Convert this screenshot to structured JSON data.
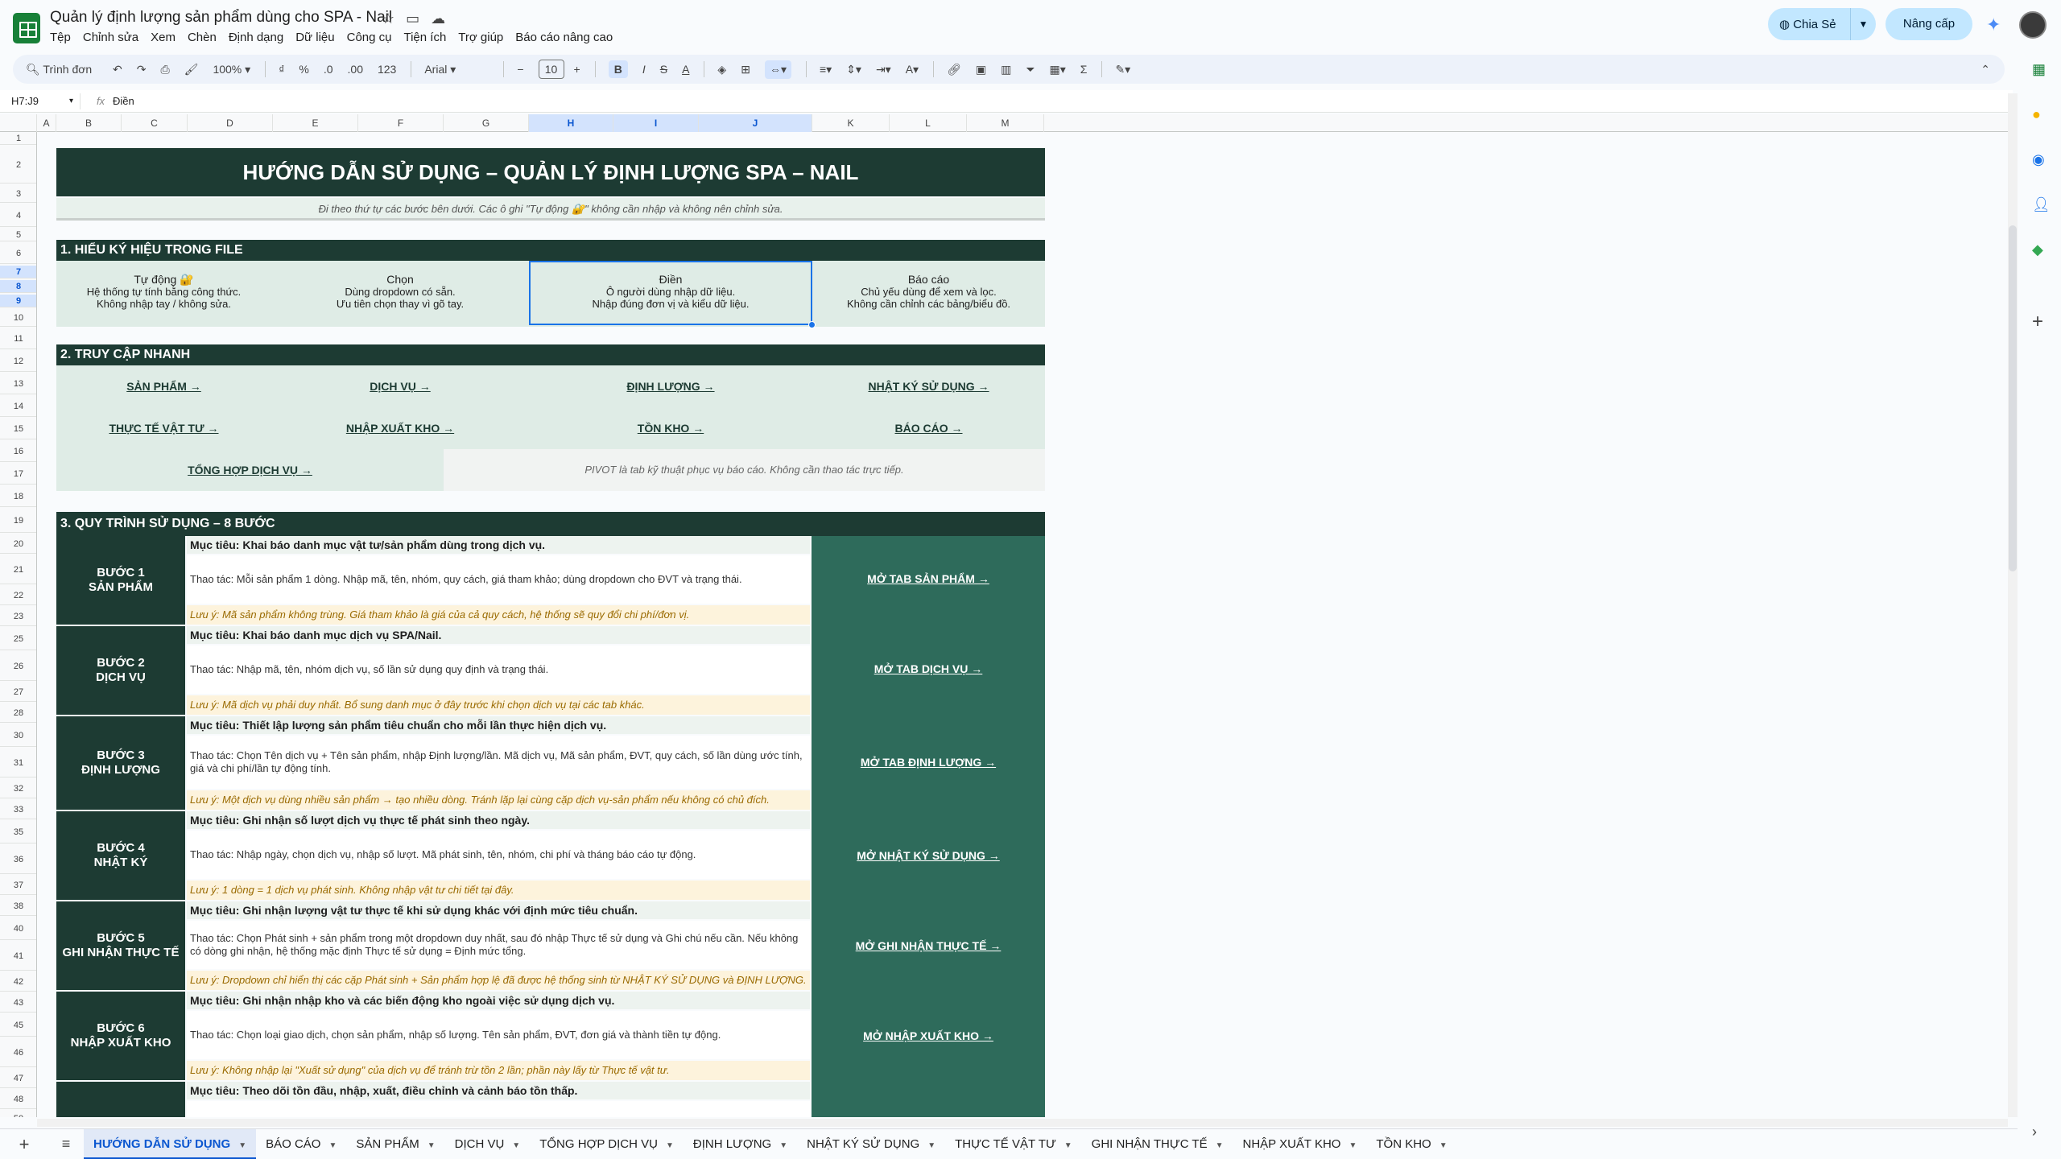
{
  "doc_title": "Quản lý định lượng sản phẩm dùng cho SPA - Nail",
  "menu": [
    "Tệp",
    "Chỉnh sửa",
    "Xem",
    "Chèn",
    "Định dạng",
    "Dữ liệu",
    "Công cụ",
    "Tiện ích",
    "Trợ giúp",
    "Báo cáo nâng cao"
  ],
  "share_label": "Chia Sẻ",
  "upgrade_label": "Nâng cấp",
  "toolbar": {
    "search": "Trình đơn",
    "zoom": "100%",
    "font": "Arial",
    "font_size": "10",
    "currency": "₫",
    "percent": "%",
    "dec_dec": ".0",
    "dec_inc": ".00",
    "num_fmt": "123"
  },
  "namebox": "H7:J9",
  "formula": "Điền",
  "columns": [
    "A",
    "B",
    "C",
    "D",
    "E",
    "F",
    "G",
    "H",
    "I",
    "J",
    "K",
    "L",
    "M"
  ],
  "rows": [
    "1",
    "2",
    "3",
    "4",
    "5",
    "6",
    "7",
    "8",
    "9",
    "10",
    "11",
    "12",
    "13",
    "14",
    "15",
    "16",
    "17",
    "18",
    "19",
    "20",
    "21",
    "22",
    "23",
    "25",
    "26",
    "27",
    "28",
    "30",
    "31",
    "32",
    "33",
    "35",
    "36",
    "37",
    "38",
    "40",
    "41",
    "42",
    "43",
    "45",
    "46",
    "47",
    "48",
    "50"
  ],
  "main_title": "HƯỚNG DẪN SỬ DỤNG – QUẢN LÝ ĐỊNH LƯỢNG SPA – NAIL",
  "subnote": "Đi theo thứ tự các bước bên dưới. Các ô ghi \"Tự động 🔐\" không cần nhập và không nên chỉnh sửa.",
  "sec1": "1. HIỂU KÝ HIỆU TRONG FILE",
  "legend": [
    {
      "h": "Tự động 🔐",
      "l1": "Hệ thống tự tính bằng công thức.",
      "l2": "Không nhập tay / không sửa."
    },
    {
      "h": "Chọn",
      "l1": "Dùng dropdown có sẵn.",
      "l2": "Ưu tiên chọn thay vì gõ tay."
    },
    {
      "h": "Điền",
      "l1": "Ô người dùng nhập dữ liệu.",
      "l2": "Nhập đúng đơn vị và kiểu dữ liệu."
    },
    {
      "h": "Báo cáo",
      "l1": "Chủ yếu dùng để xem và lọc.",
      "l2": "Không cần chỉnh các bảng/biểu đồ."
    }
  ],
  "sec2": "2. TRUY CẬP NHANH",
  "quick_links": [
    "SẢN PHẨM →",
    "DỊCH VỤ →",
    "ĐỊNH LƯỢNG →",
    "NHẬT KÝ SỬ DỤNG →",
    "THỰC TẾ VẬT TƯ →",
    "NHẬP XUẤT KHO →",
    "TỒN KHO →",
    "BÁO CÁO →",
    "TỔNG HỢP DỊCH VỤ →"
  ],
  "pivot_note": "PIVOT là tab kỹ thuật phục vụ báo cáo. Không cần thao tác trực tiếp.",
  "sec3": "3. QUY TRÌNH SỬ DỤNG – 8 BƯỚC",
  "steps": [
    {
      "l1": "BƯỚC 1",
      "l2": "SẢN PHẨM",
      "goal": "Mục tiêu: Khai báo danh mục vật tư/sản phẩm dùng trong dịch vụ.",
      "op": "Thao tác: Mỗi sản phẩm 1 dòng. Nhập mã, tên, nhóm, quy cách, giá tham khảo; dùng dropdown cho ĐVT và trạng thái.",
      "note": "Lưu ý: Mã sản phẩm không trùng. Giá tham khảo là giá của cả quy cách, hệ thống sẽ quy đổi chi phí/đơn vị.",
      "link": "MỞ TAB SẢN PHẨM →"
    },
    {
      "l1": "BƯỚC 2",
      "l2": "DỊCH VỤ",
      "goal": "Mục tiêu: Khai báo danh mục dịch vụ SPA/Nail.",
      "op": "Thao tác: Nhập mã, tên, nhóm dịch vụ, số lần sử dụng quy định và trạng thái.",
      "note": "Lưu ý: Mã dịch vụ phải duy nhất. Bổ sung danh mục ở đây trước khi chọn dịch vụ tại các tab khác.",
      "link": "MỞ TAB DỊCH VỤ →"
    },
    {
      "l1": "BƯỚC 3",
      "l2": "ĐỊNH LƯỢNG",
      "goal": "Mục tiêu: Thiết lập lượng sản phẩm tiêu chuẩn cho mỗi lần thực hiện dịch vụ.",
      "op": "Thao tác: Chọn Tên dịch vụ + Tên sản phẩm, nhập Định lượng/lần. Mã dịch vụ, Mã sản phẩm, ĐVT, quy cách, số lần dùng ước tính, giá và chi phí/lần tự động tính.",
      "note": "Lưu ý: Một dịch vụ dùng nhiều sản phẩm → tạo nhiều dòng. Tránh lặp lại cùng cặp dịch vụ-sản phẩm nếu không có chủ đích.",
      "link": "MỞ TAB ĐỊNH LƯỢNG →"
    },
    {
      "l1": "BƯỚC 4",
      "l2": "NHẬT KÝ",
      "goal": "Mục tiêu: Ghi nhận số lượt dịch vụ thực tế phát sinh theo ngày.",
      "op": "Thao tác: Nhập ngày, chọn dịch vụ, nhập số lượt. Mã phát sinh, tên, nhóm, chi phí và tháng báo cáo tự động.",
      "note": "Lưu ý: 1 dòng = 1 dịch vụ phát sinh. Không nhập vật tư chi tiết tại đây.",
      "link": "MỞ NHẬT KÝ SỬ DỤNG →"
    },
    {
      "l1": "BƯỚC 5",
      "l2": "GHI NHẬN THỰC TẾ",
      "goal": "Mục tiêu: Ghi nhận lượng vật tư thực tế khi sử dụng khác với định mức tiêu chuẩn.",
      "op": "Thao tác: Chọn Phát sinh + sản phẩm trong một dropdown duy nhất, sau đó nhập Thực tế sử dụng và Ghi chú nếu cần. Nếu không có dòng ghi nhận, hệ thống mặc định Thực tế sử dụng = Định mức tổng.",
      "note": "Lưu ý: Dropdown chỉ hiển thị các cặp Phát sinh + Sản phẩm hợp lệ đã được hệ thống sinh từ NHẬT KÝ SỬ DỤNG và ĐỊNH LƯỢNG.",
      "link": "MỞ GHI NHẬN THỰC TẾ →"
    },
    {
      "l1": "BƯỚC 6",
      "l2": "NHẬP XUẤT KHO",
      "goal": "Mục tiêu: Ghi nhận nhập kho và các biến động kho ngoài việc sử dụng dịch vụ.",
      "op": "Thao tác: Chọn loại giao dịch, chọn sản phẩm, nhập số lượng. Tên sản phẩm, ĐVT, đơn giá và thành tiền tự động.",
      "note": "Lưu ý: Không nhập lại \"Xuất sử dụng\" của dịch vụ để tránh trừ tồn 2 lần; phần này lấy từ Thực tế vật tư.",
      "link": "MỞ NHẬP XUẤT KHO →"
    },
    {
      "goal": "Mục tiêu: Theo dõi tồn đầu, nhập, xuất, điều chỉnh và cảnh báo tồn thấp."
    }
  ],
  "tabs": [
    "HƯỚNG DẪN SỬ DỤNG",
    "BÁO CÁO",
    "SẢN PHẨM",
    "DỊCH VỤ",
    "TỔNG HỢP DỊCH VỤ",
    "ĐỊNH LƯỢNG",
    "NHẬT KÝ SỬ DỤNG",
    "THỰC TẾ VẬT TƯ",
    "GHI NHẬN THỰC TẾ",
    "NHẬP XUẤT KHO",
    "TỒN KHO"
  ]
}
